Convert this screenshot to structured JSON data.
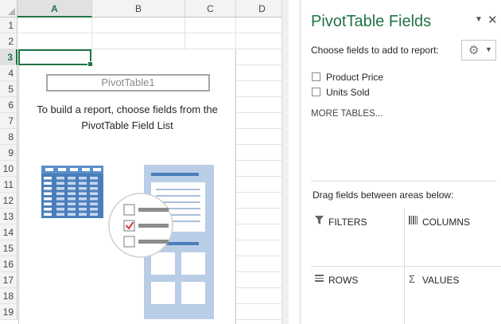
{
  "spreadsheet": {
    "columns": [
      {
        "label": "A",
        "selected": true
      },
      {
        "label": "B",
        "selected": false
      },
      {
        "label": "C",
        "selected": false
      },
      {
        "label": "D",
        "selected": false
      }
    ],
    "rows": [
      "1",
      "2",
      "3",
      "4",
      "5",
      "6",
      "7",
      "8",
      "9",
      "10",
      "11",
      "12",
      "13",
      "14",
      "15",
      "16",
      "17",
      "18",
      "19"
    ],
    "active_row": "3",
    "accent_color": "#217346"
  },
  "pivot_placeholder": {
    "name": "PivotTable1",
    "message_line1": "To build a report, choose fields from the",
    "message_line2": "PivotTable Field List",
    "art_color": "#4a7ebb"
  },
  "task_pane": {
    "title": "PivotTable Fields",
    "dropdown_icon": "chevron-down-icon",
    "close_glyph": "✕",
    "subtitle": "Choose fields to add to report:",
    "settings_icon": "gear-icon",
    "fields": [
      {
        "label": "Product Price",
        "checked": false
      },
      {
        "label": "Units Sold",
        "checked": false
      }
    ],
    "more_tables": "MORE TABLES...",
    "drag_label": "Drag fields between areas below:",
    "areas": {
      "filters": "FILTERS",
      "columns": "COLUMNS",
      "rows": "ROWS",
      "values": "VALUES"
    }
  }
}
